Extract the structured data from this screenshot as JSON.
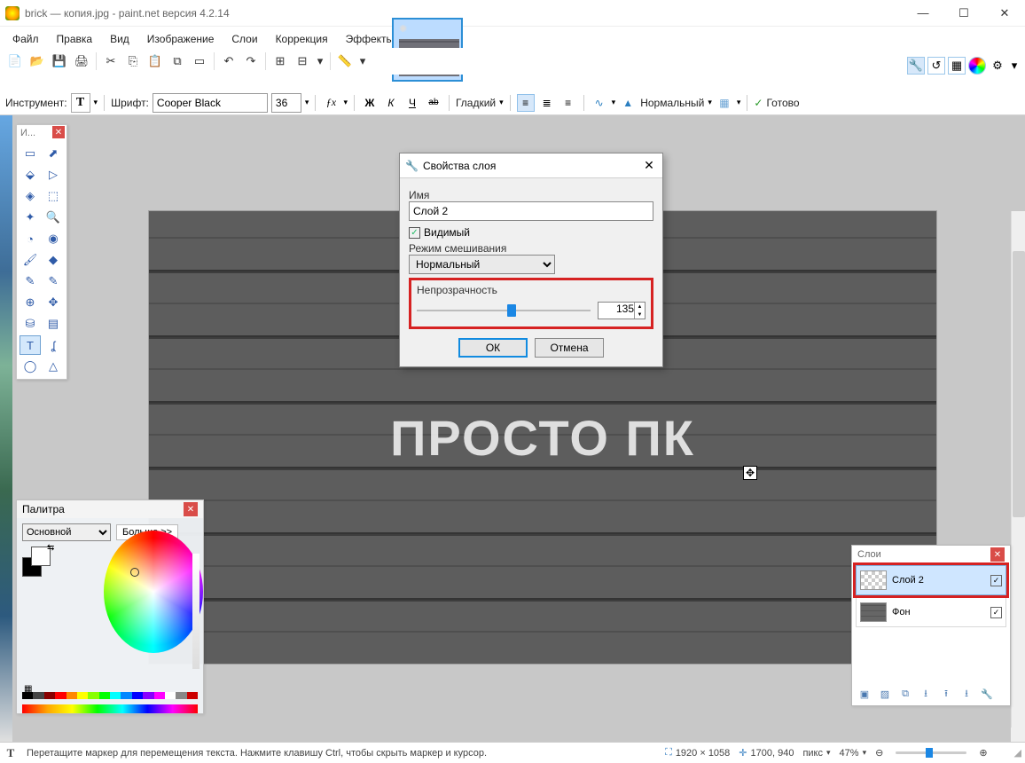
{
  "window": {
    "title": "brick — копия.jpg - paint.net версия 4.2.14",
    "thumb_text": "ПРОСТО ПК"
  },
  "menu": {
    "items": [
      "Файл",
      "Правка",
      "Вид",
      "Изображение",
      "Слои",
      "Коррекция",
      "Эффекты"
    ]
  },
  "top_panel_icons": {
    "wrench": "🔧",
    "history": "↺",
    "grid": "▦",
    "wheel": "◉",
    "gear": "⚙",
    "drop": "▾"
  },
  "text_toolbar": {
    "tool_label": "Инструмент:",
    "font_label": "Шрифт:",
    "font_value": "Cooper Black",
    "size_value": "36",
    "fx": "fx",
    "bold": "Ж",
    "italic": "К",
    "underline": "Ч",
    "strike": "ab",
    "aa_label": "Гладкий",
    "mode_label": "Нормальный",
    "done_label": "Готово"
  },
  "tools_window": {
    "title": "И...",
    "items": [
      "▭",
      "⬈",
      "⬙",
      "▷",
      "◈",
      "⬚",
      "✦",
      "🔍",
      "◔",
      "◉",
      "🖌",
      "◆",
      "✎",
      "✎",
      "⊕",
      "✥",
      "⛁",
      "▤",
      "T",
      "ʆ",
      "◯",
      "△"
    ]
  },
  "layer_dialog": {
    "title": "Свойства слоя",
    "name_label": "Имя",
    "name_value": "Слой 2",
    "visible_label": "Видимый",
    "visible_checked": true,
    "blend_label": "Режим смешивания",
    "blend_value": "Нормальный",
    "opacity_label": "Непрозрачность",
    "opacity_value": "135",
    "ok": "ОК",
    "cancel": "Отмена"
  },
  "palette": {
    "title": "Палитра",
    "mode": "Основной",
    "more": "Больше >>"
  },
  "layers": {
    "title": "Слои",
    "items": [
      {
        "name": "Слой 2",
        "checked": true,
        "selected": true
      },
      {
        "name": "Фон",
        "checked": true,
        "selected": false
      }
    ]
  },
  "status": {
    "hint": "Перетащите маркер для перемещения текста. Нажмите клавишу Ctrl, чтобы скрыть маркер и курсор.",
    "doc_size": "1920 × 1058",
    "cursor": "1700, 940",
    "unit": "пикс",
    "zoom": "47%"
  },
  "canvas": {
    "text": "ПРОСТО ПК"
  }
}
